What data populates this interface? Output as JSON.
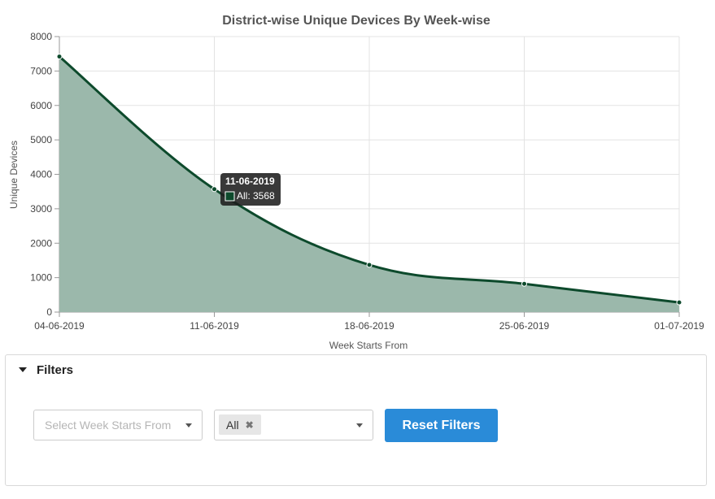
{
  "chart_data": {
    "type": "area",
    "title": "District-wise Unique Devices By Week-wise",
    "xlabel": "Week Starts From",
    "ylabel": "Unique Devices",
    "categories": [
      "04-06-2019",
      "11-06-2019",
      "18-06-2019",
      "25-06-2019",
      "01-07-2019"
    ],
    "series": [
      {
        "name": "All",
        "values": [
          7420,
          3568,
          1370,
          820,
          280
        ]
      }
    ],
    "ylim": [
      0,
      8000
    ],
    "yticks": [
      "0",
      "1000",
      "2000",
      "3000",
      "4000",
      "5000",
      "6000",
      "7000",
      "8000"
    ],
    "grid": true,
    "colors": {
      "line": "#0d4a2c",
      "fill": "#9bb8ab",
      "grid": "#e3e3e3",
      "axis": "#999999"
    },
    "tooltip": {
      "title": "11-06-2019",
      "label": "All: 3568"
    }
  },
  "filters": {
    "title": "Filters",
    "week_placeholder": "Select Week Starts From",
    "district_tag": "All",
    "tag_remove": "✖",
    "reset_label": "Reset Filters"
  }
}
